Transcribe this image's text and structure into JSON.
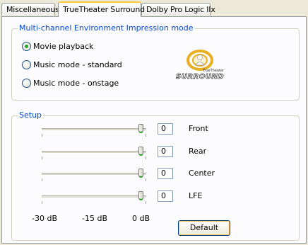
{
  "tabs": [
    {
      "label": "Miscellaneous"
    },
    {
      "label": "TrueTheater Surround"
    },
    {
      "label": "Dolby Pro Logic IIx"
    }
  ],
  "env_group": {
    "title": "Multi-channel Environment Impression mode",
    "options": [
      {
        "label": "Movie playback",
        "checked": true
      },
      {
        "label": "Music mode - standard",
        "checked": false
      },
      {
        "label": "Music mode - onstage",
        "checked": false
      }
    ]
  },
  "logo": {
    "text_small": "TrueTheater",
    "text_main": "SURROUND",
    "accent": "#e8b020"
  },
  "setup": {
    "title": "Setup",
    "channels": [
      {
        "label": "Front",
        "value": "0"
      },
      {
        "label": "Rear",
        "value": "0"
      },
      {
        "label": "Center",
        "value": "0"
      },
      {
        "label": "LFE",
        "value": "0"
      }
    ],
    "scale": {
      "min": "-30 dB",
      "mid": "-15 dB",
      "max": "0 dB"
    },
    "default_button": "Default"
  },
  "colors": {
    "selected_tab_accent": "#ffc83c",
    "group_title": "#0046d5",
    "radio_check": "#21a121"
  }
}
